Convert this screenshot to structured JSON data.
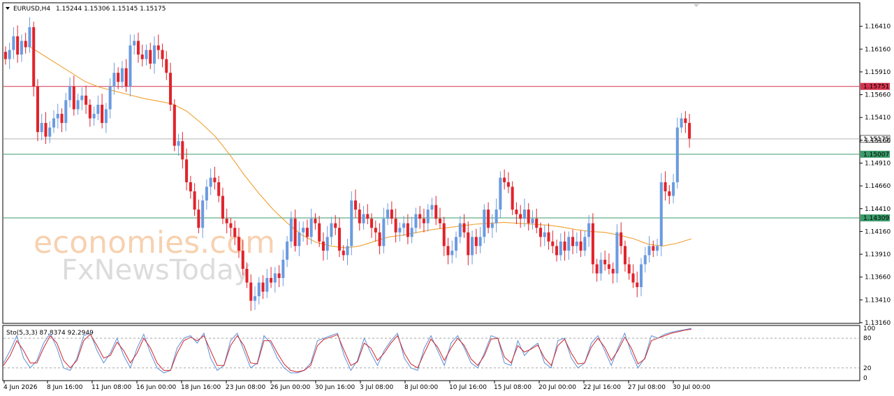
{
  "chart_data": {
    "type": "candlestick",
    "header": {
      "symbol": "EURUSD,H4",
      "ohlc": "1.15244 1.15306 1.15145 1.15175"
    },
    "price_axis": {
      "min": 1.1316,
      "max": 1.1666,
      "ticks": [
        "1.16410",
        "1.16160",
        "1.15910",
        "1.15660",
        "1.15410",
        "1.15160",
        "1.14910",
        "1.14660",
        "1.14410",
        "1.14160",
        "1.13910",
        "1.13660",
        "1.13410",
        "1.13160"
      ]
    },
    "levels": [
      {
        "value": 1.15751,
        "label": "1.15751",
        "color": "#d6344f"
      },
      {
        "value": 1.15175,
        "label": "1.15175",
        "color": "#b0b0b0"
      },
      {
        "value": 1.15007,
        "label": "1.15007",
        "color": "#3a9b6a"
      },
      {
        "value": 1.14309,
        "label": "1.14309",
        "color": "#3a9b6a"
      }
    ],
    "x_labels": [
      "4 Jun 2026",
      "8 Jun 16:00",
      "11 Jun 08:00",
      "16 Jun 00:00",
      "18 Jun 16:00",
      "23 Jun 08:00",
      "26 Jun 00:00",
      "30 Jun 16:00",
      "3 Jul 08:00",
      "8 Jul 00:00",
      "10 Jul 16:00",
      "15 Jul 08:00",
      "20 Jul 00:00",
      "22 Jul 16:00",
      "27 Jul 08:00",
      "30 Jul 00:00"
    ],
    "bull_color": "#6b9be0",
    "bear_color": "#e0232b",
    "ma_color": "#f0a030",
    "closes": [
      1.1605,
      1.1615,
      1.163,
      1.161,
      1.1625,
      1.1618,
      1.164,
      1.1575,
      1.1525,
      1.1535,
      1.152,
      1.153,
      1.154,
      1.1545,
      1.1535,
      1.156,
      1.1575,
      1.155,
      1.156,
      1.1565,
      1.1555,
      1.154,
      1.1545,
      1.1555,
      1.1535,
      1.155,
      1.1575,
      1.159,
      1.158,
      1.1595,
      1.1575,
      1.162,
      1.1625,
      1.161,
      1.1605,
      1.1615,
      1.16,
      1.162,
      1.1615,
      1.1605,
      1.159,
      1.1555,
      1.151,
      1.1515,
      1.1495,
      1.147,
      1.146,
      1.144,
      1.142,
      1.145,
      1.1465,
      1.1475,
      1.147,
      1.1455,
      1.143,
      1.1425,
      1.142,
      1.141,
      1.1395,
      1.1375,
      1.136,
      1.134,
      1.1345,
      1.136,
      1.135,
      1.1365,
      1.136,
      1.137,
      1.1365,
      1.1385,
      1.1405,
      1.143,
      1.14,
      1.1415,
      1.142,
      1.141,
      1.143,
      1.1425,
      1.1405,
      1.1395,
      1.141,
      1.1425,
      1.142,
      1.1395,
      1.139,
      1.14,
      1.145,
      1.144,
      1.1425,
      1.1435,
      1.143,
      1.142,
      1.1415,
      1.14,
      1.143,
      1.144,
      1.143,
      1.1415,
      1.142,
      1.1425,
      1.141,
      1.142,
      1.1435,
      1.143,
      1.1425,
      1.144,
      1.1445,
      1.143,
      1.1425,
      1.14,
      1.139,
      1.1395,
      1.141,
      1.1425,
      1.1415,
      1.139,
      1.141,
      1.14,
      1.141,
      1.144,
      1.142,
      1.1425,
      1.144,
      1.1475,
      1.147,
      1.1465,
      1.144,
      1.1435,
      1.143,
      1.144,
      1.1425,
      1.143,
      1.142,
      1.141,
      1.1415,
      1.1405,
      1.14,
      1.139,
      1.1405,
      1.1395,
      1.141,
      1.14,
      1.1405,
      1.1395,
      1.141,
      1.1425,
      1.138,
      1.137,
      1.1385,
      1.138,
      1.1375,
      1.137,
      1.1415,
      1.14,
      1.138,
      1.137,
      1.136,
      1.1355,
      1.138,
      1.139,
      1.14,
      1.1395,
      1.14,
      1.147,
      1.146,
      1.1455,
      1.147,
      1.153,
      1.154,
      1.1535,
      1.1518
    ],
    "sma_ohlc_note": "",
    "ma": [
      1.162,
      1.161,
      1.16,
      1.159,
      1.158,
      1.1574,
      1.157,
      1.1566,
      1.1562,
      1.1559,
      1.1556,
      1.1548,
      1.1535,
      1.152,
      1.15,
      1.1478,
      1.1458,
      1.144,
      1.1425,
      1.1412,
      1.1404,
      1.14,
      1.1398,
      1.14,
      1.1405,
      1.141,
      1.1412,
      1.1415,
      1.1418,
      1.142,
      1.1422,
      1.1424,
      1.1425,
      1.1426,
      1.1425,
      1.1424,
      1.1423,
      1.1421,
      1.1418,
      1.1416,
      1.1415,
      1.1412,
      1.1408,
      1.1402,
      1.14,
      1.1403,
      1.1408
    ],
    "indicator": {
      "name": "Sto(5,3,3) 87.8374 92.2949",
      "ticks": [
        "100",
        "80",
        "20",
        "0"
      ],
      "levels": [
        80,
        20
      ],
      "main_color": "#5b8fd8",
      "signal_color": "#d0242b",
      "main": [
        30,
        55,
        85,
        40,
        20,
        35,
        70,
        90,
        60,
        20,
        15,
        40,
        85,
        90,
        55,
        30,
        50,
        80,
        45,
        20,
        60,
        88,
        50,
        20,
        10,
        15,
        60,
        80,
        85,
        70,
        90,
        40,
        15,
        25,
        75,
        90,
        55,
        20,
        30,
        85,
        70,
        40,
        20,
        10,
        10,
        15,
        30,
        75,
        80,
        85,
        90,
        45,
        15,
        35,
        80,
        50,
        25,
        55,
        75,
        90,
        40,
        20,
        15,
        60,
        85,
        55,
        25,
        70,
        85,
        60,
        30,
        20,
        50,
        85,
        80,
        30,
        25,
        75,
        45,
        60,
        70,
        30,
        20,
        75,
        80,
        40,
        20,
        30,
        70,
        85,
        55,
        25,
        60,
        90,
        50,
        20,
        40,
        85,
        80,
        88,
        92,
        95,
        97,
        100
      ],
      "signal": [
        25,
        45,
        75,
        55,
        30,
        30,
        60,
        85,
        70,
        35,
        20,
        35,
        75,
        88,
        65,
        40,
        45,
        72,
        55,
        30,
        50,
        80,
        60,
        30,
        15,
        15,
        50,
        75,
        82,
        75,
        85,
        55,
        25,
        25,
        65,
        85,
        65,
        30,
        28,
        75,
        75,
        50,
        28,
        15,
        12,
        15,
        25,
        65,
        78,
        82,
        87,
        55,
        25,
        32,
        70,
        60,
        35,
        50,
        70,
        85,
        50,
        28,
        20,
        50,
        78,
        62,
        35,
        60,
        80,
        65,
        38,
        25,
        45,
        78,
        80,
        42,
        30,
        65,
        52,
        58,
        66,
        40,
        25,
        65,
        78,
        50,
        28,
        30,
        62,
        80,
        62,
        35,
        55,
        82,
        60,
        28,
        38,
        75,
        80,
        85,
        90,
        93,
        96,
        98
      ]
    }
  }
}
